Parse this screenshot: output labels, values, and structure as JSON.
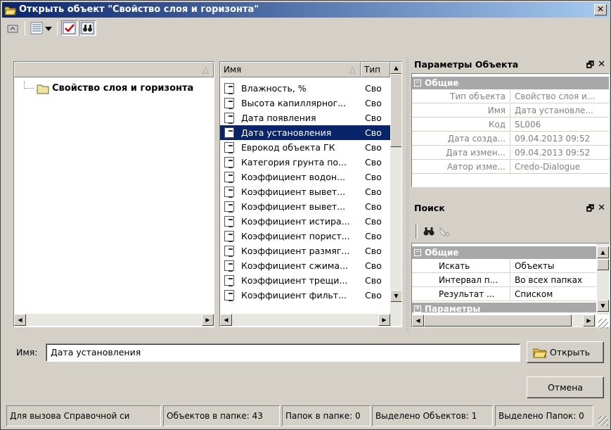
{
  "window": {
    "title": "Открыть объект \"Свойство слоя и горизонта\"",
    "close_glyph": "✕"
  },
  "tree": {
    "root_label": "Свойство слоя и горизонта"
  },
  "list": {
    "columns": {
      "name": "Имя",
      "type": "Тип"
    },
    "items": [
      {
        "name": "Влажность, %",
        "type": "Сво"
      },
      {
        "name": "Высота капиллярног...",
        "type": "Сво"
      },
      {
        "name": "Дата появления",
        "type": "Сво"
      },
      {
        "name": "Дата установления",
        "type": "Сво",
        "selected": true
      },
      {
        "name": "Еврокод объекта ГК",
        "type": "Сво"
      },
      {
        "name": "Категория грунта по...",
        "type": "Сво"
      },
      {
        "name": "Коэффициент водон...",
        "type": "Сво"
      },
      {
        "name": "Коэффициент вывет...",
        "type": "Сво"
      },
      {
        "name": "Коэффициент вывет...",
        "type": "Сво"
      },
      {
        "name": "Коэффициент истира...",
        "type": "Сво"
      },
      {
        "name": "Коэффициент порист...",
        "type": "Сво"
      },
      {
        "name": "Коэффициент размяг...",
        "type": "Сво"
      },
      {
        "name": "Коэффициент сжима...",
        "type": "Сво"
      },
      {
        "name": "Коэффициент трещи...",
        "type": "Сво"
      },
      {
        "name": "Коэффициент фильт...",
        "type": "Сво"
      }
    ]
  },
  "params": {
    "title": "Параметры Объекта",
    "group": "Общие",
    "rows": [
      {
        "key": "Тип объекта",
        "value": "Свойство слоя и..."
      },
      {
        "key": "Имя",
        "value": "Дата установле..."
      },
      {
        "key": "Код",
        "value": "SL006"
      },
      {
        "key": "Дата созда...",
        "value": "09.04.2013 09:52"
      },
      {
        "key": "Дата измен...",
        "value": "09.04.2013 09:52"
      },
      {
        "key": "Автор изме...",
        "value": "Credo-Dialogue"
      }
    ]
  },
  "search": {
    "title": "Поиск",
    "group": "Общие",
    "rows": [
      {
        "key": "Искать",
        "value": "Объекты"
      },
      {
        "key": "Интервал п...",
        "value": "Во всех папках"
      },
      {
        "key": "Результат ...",
        "value": "Списком"
      }
    ],
    "next_group": "Параметры"
  },
  "name_field": {
    "label": "Имя:",
    "value": "Дата установления"
  },
  "buttons": {
    "open": "Открыть",
    "cancel": "Отмена"
  },
  "statusbar": [
    "Для вызова Справочной си",
    "Объектов в папке: 43",
    "Папок в папке: 0",
    "Выделено Объектов: 1",
    "Выделено Папок: 0"
  ],
  "colors": {
    "title_start": "#0a246a",
    "title_end": "#a6caf0",
    "selection": "#0a246a",
    "group_header": "#a8a8a8"
  }
}
